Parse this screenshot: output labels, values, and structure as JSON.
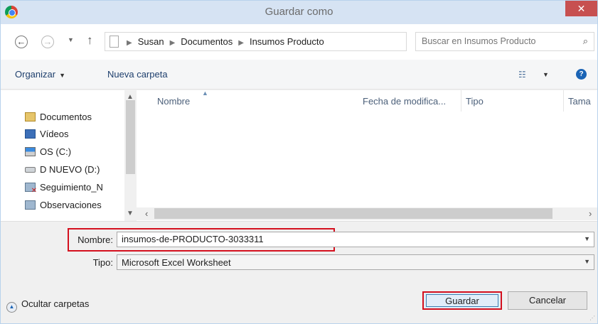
{
  "window": {
    "title": "Guardar como",
    "close_glyph": "✕"
  },
  "address_bar": {
    "breadcrumb": [
      "Susan",
      "Documentos",
      "Insumos Producto"
    ],
    "search_placeholder": "Buscar en Insumos Producto"
  },
  "toolbar": {
    "organize_label": "Organizar",
    "new_folder_label": "Nueva carpeta"
  },
  "nav_pane": {
    "items": [
      {
        "label": "Documentos",
        "icon": "documents-folder-icon"
      },
      {
        "label": "Vídeos",
        "icon": "videos-folder-icon"
      },
      {
        "label": "OS (C:)",
        "icon": "os-drive-icon"
      },
      {
        "label": "D NUEVO (D:)",
        "icon": "drive-icon"
      },
      {
        "label": "Seguimiento_N",
        "icon": "disconnected-network-drive-icon"
      },
      {
        "label": "Observaciones",
        "icon": "network-drive-icon"
      }
    ]
  },
  "file_list": {
    "columns": [
      "Nombre",
      "Fecha de modifica...",
      "Tipo",
      "Tama"
    ]
  },
  "form": {
    "name_label": "Nombre:",
    "name_value": "insumos-de-PRODUCTO-3033311",
    "type_label": "Tipo:",
    "type_value": "Microsoft Excel Worksheet"
  },
  "footer": {
    "hide_folders_label": "Ocultar carpetas",
    "save_label": "Guardar",
    "cancel_label": "Cancelar"
  },
  "colors": {
    "highlight": "#d4101e",
    "title_bar": "#d6e3f3",
    "close_button": "#c75050"
  }
}
